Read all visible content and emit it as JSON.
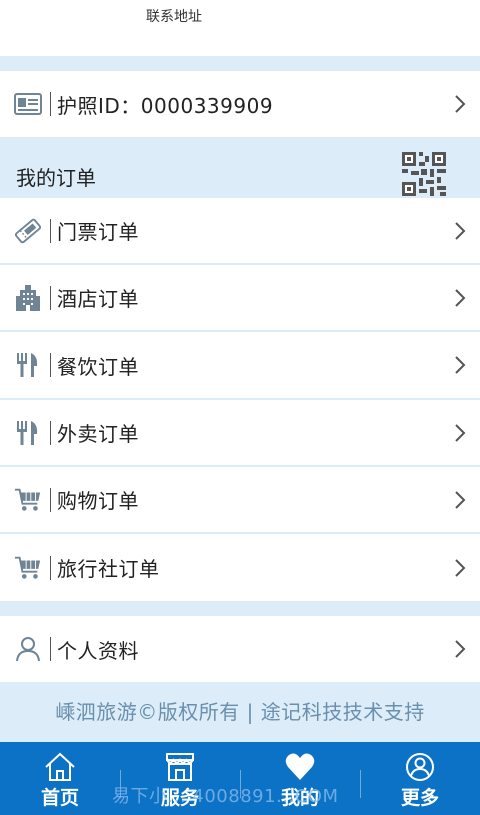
{
  "top": {
    "address_label": "联系地址"
  },
  "passport": {
    "label": "护照ID：0000339909"
  },
  "orders": {
    "title": "我的订单",
    "items": [
      {
        "label": "门票订单",
        "icon": "ticket-icon"
      },
      {
        "label": "酒店订单",
        "icon": "hotel-icon"
      },
      {
        "label": "餐饮订单",
        "icon": "fork-knife-icon"
      },
      {
        "label": "外卖订单",
        "icon": "fork-knife-icon"
      },
      {
        "label": "购物订单",
        "icon": "cart-icon"
      },
      {
        "label": "旅行社订单",
        "icon": "cart-icon"
      }
    ]
  },
  "profile": {
    "label": "个人资料"
  },
  "footer": {
    "copyright": "嵊泗旅游©版权所有 | 途记科技技术支持"
  },
  "tabbar": {
    "tabs": [
      {
        "label": "首页",
        "icon": "home-icon"
      },
      {
        "label": "服务",
        "icon": "store-icon"
      },
      {
        "label": "我的",
        "icon": "heart-icon"
      },
      {
        "label": "更多",
        "icon": "user-circle-icon"
      }
    ]
  },
  "watermark": {
    "text": "易下小... 4008891...COM"
  },
  "colors": {
    "accent": "#0b72c6",
    "background": "#dcedf9",
    "footer_text": "#6a8fae",
    "icon": "#6f8494"
  }
}
